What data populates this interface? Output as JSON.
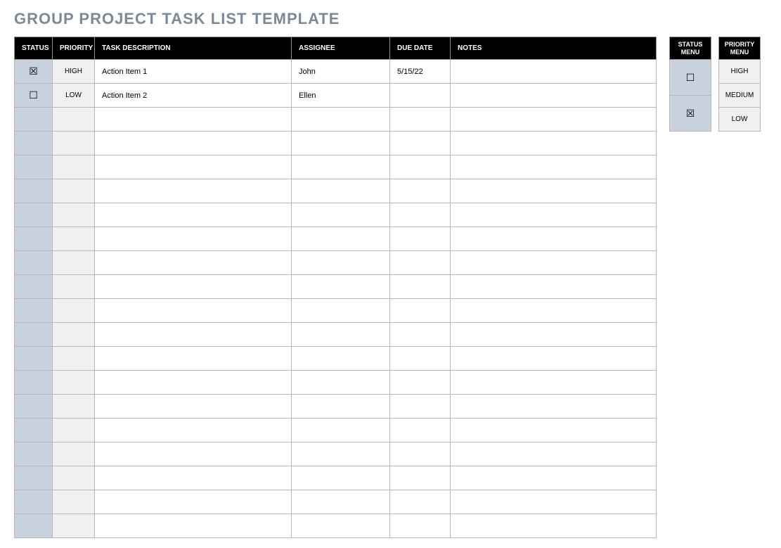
{
  "title": "GROUP PROJECT TASK LIST TEMPLATE",
  "table": {
    "headers": {
      "status": "STATUS",
      "priority": "PRIORITY",
      "task": "TASK DESCRIPTION",
      "assignee": "ASSIGNEE",
      "duedate": "DUE DATE",
      "notes": "NOTES"
    },
    "rows": [
      {
        "status": "☒",
        "priority": "HIGH",
        "task": "Action Item 1",
        "assignee": "John",
        "duedate": "5/15/22",
        "notes": ""
      },
      {
        "status": "☐",
        "priority": "LOW",
        "task": "Action Item 2",
        "assignee": "Ellen",
        "duedate": "",
        "notes": ""
      },
      {
        "status": "",
        "priority": "",
        "task": "",
        "assignee": "",
        "duedate": "",
        "notes": ""
      },
      {
        "status": "",
        "priority": "",
        "task": "",
        "assignee": "",
        "duedate": "",
        "notes": ""
      },
      {
        "status": "",
        "priority": "",
        "task": "",
        "assignee": "",
        "duedate": "",
        "notes": ""
      },
      {
        "status": "",
        "priority": "",
        "task": "",
        "assignee": "",
        "duedate": "",
        "notes": ""
      },
      {
        "status": "",
        "priority": "",
        "task": "",
        "assignee": "",
        "duedate": "",
        "notes": ""
      },
      {
        "status": "",
        "priority": "",
        "task": "",
        "assignee": "",
        "duedate": "",
        "notes": ""
      },
      {
        "status": "",
        "priority": "",
        "task": "",
        "assignee": "",
        "duedate": "",
        "notes": ""
      },
      {
        "status": "",
        "priority": "",
        "task": "",
        "assignee": "",
        "duedate": "",
        "notes": ""
      },
      {
        "status": "",
        "priority": "",
        "task": "",
        "assignee": "",
        "duedate": "",
        "notes": ""
      },
      {
        "status": "",
        "priority": "",
        "task": "",
        "assignee": "",
        "duedate": "",
        "notes": ""
      },
      {
        "status": "",
        "priority": "",
        "task": "",
        "assignee": "",
        "duedate": "",
        "notes": ""
      },
      {
        "status": "",
        "priority": "",
        "task": "",
        "assignee": "",
        "duedate": "",
        "notes": ""
      },
      {
        "status": "",
        "priority": "",
        "task": "",
        "assignee": "",
        "duedate": "",
        "notes": ""
      },
      {
        "status": "",
        "priority": "",
        "task": "",
        "assignee": "",
        "duedate": "",
        "notes": ""
      },
      {
        "status": "",
        "priority": "",
        "task": "",
        "assignee": "",
        "duedate": "",
        "notes": ""
      },
      {
        "status": "",
        "priority": "",
        "task": "",
        "assignee": "",
        "duedate": "",
        "notes": ""
      },
      {
        "status": "",
        "priority": "",
        "task": "",
        "assignee": "",
        "duedate": "",
        "notes": ""
      },
      {
        "status": "",
        "priority": "",
        "task": "",
        "assignee": "",
        "duedate": "",
        "notes": ""
      }
    ]
  },
  "status_menu": {
    "header": "STATUS MENU",
    "items": [
      "☐",
      "☒"
    ]
  },
  "priority_menu": {
    "header": "PRIORITY MENU",
    "items": [
      "HIGH",
      "MEDIUM",
      "LOW"
    ]
  }
}
